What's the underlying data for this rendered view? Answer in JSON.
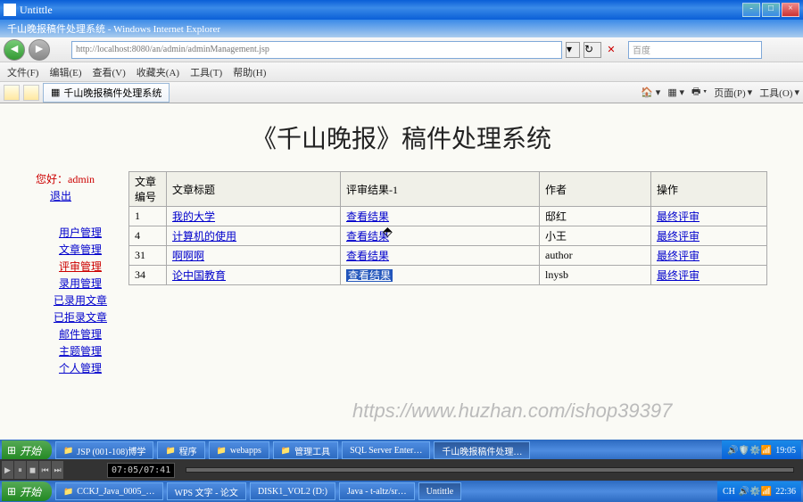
{
  "outer_window": {
    "title": "Untittle"
  },
  "ie_window": {
    "title": "千山晚报稿件处理系统 - Windows Internet Explorer",
    "url": "http://localhost:8080/an/admin/adminManagement.jsp",
    "search_placeholder": "百度"
  },
  "menu": {
    "file": "文件(F)",
    "edit": "编辑(E)",
    "view": "查看(V)",
    "favorites": "收藏夹(A)",
    "tools": "工具(T)",
    "help": "帮助(H)"
  },
  "tab": {
    "title": "千山晚报稿件处理系统"
  },
  "fav_tools": {
    "home": "主页(I)",
    "print": "页面(P)",
    "page": "工具(O)"
  },
  "page": {
    "title": "《千山晚报》稿件处理系统",
    "greeting": "您好：admin",
    "logout": "退出",
    "nav": [
      "用户管理",
      "文章管理",
      "评审管理",
      "录用管理",
      "已录用文章",
      "已拒录文章",
      "邮件管理",
      "主题管理",
      "个人管理"
    ]
  },
  "table": {
    "headers": {
      "id": "文章编号",
      "title": "文章标题",
      "review": "评审结果-1",
      "author": "作者",
      "op": "操作"
    },
    "rows": [
      {
        "id": "1",
        "title": "我的大学",
        "review": "查看结果",
        "author": "邸红",
        "op": "最终评审"
      },
      {
        "id": "4",
        "title": "计算机的使用",
        "review": "查看结果",
        "author": "小王",
        "op": "最终评审"
      },
      {
        "id": "31",
        "title": "啊啊啊",
        "review": "查看结果",
        "author": "author",
        "op": "最终评审"
      },
      {
        "id": "34",
        "title": "论中国教育",
        "review": "查看结果",
        "author": "lnysb",
        "op": "最终评审"
      }
    ]
  },
  "watermark": "https://www.huzhan.com/ishop39397",
  "taskbars": {
    "tb1": {
      "start": "开始",
      "tasks": [
        "JSP (001-108)博学",
        "程序",
        "webapps",
        "管理工具",
        "SQL Server Enter…",
        "千山晚报稿件处理…"
      ],
      "tray_time": "19:05"
    },
    "tb2": {
      "time_display": "07:05/07:41"
    },
    "tb3": {
      "start": "开始",
      "tasks": [
        "CCKJ_Java_0005_…",
        "WPS 文字 - 论文",
        "DISK1_VOL2 (D:)",
        "Java - t-altz/sr…",
        "Untittle"
      ],
      "tray_time": "22:36",
      "tray_lang": "CH"
    }
  }
}
